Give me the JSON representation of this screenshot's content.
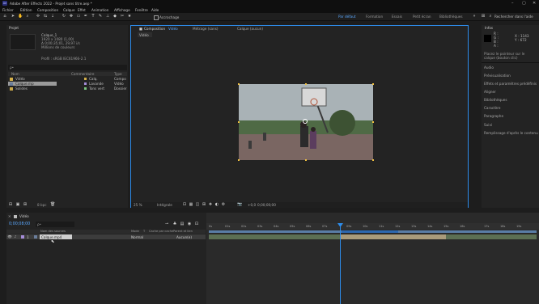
{
  "window": {
    "title": "Adobe After Effects 2022 - Projet sans titre.aep *",
    "min": "–",
    "max": "▢",
    "close": "✕"
  },
  "menu": [
    "Fichier",
    "Edition",
    "Composition",
    "Calque",
    "Effet",
    "Animation",
    "Affichage",
    "Fenêtre",
    "Aide"
  ],
  "toolbar": {
    "snap_label": "Accrochage",
    "workspaces": [
      "Par défaut",
      "Formation",
      "Essais",
      "Petit écran",
      "Bibliothèques"
    ],
    "help_search": "Rechercher dans l'aide"
  },
  "project": {
    "tab": "Projet",
    "comp_name": "Calque_1",
    "comp_info1": "1920 x 1080 (1,00)",
    "comp_info2": "Δ 0;00;35;01, 29,97 i/s",
    "comp_info3": "Millions de couleurs",
    "comp_info4": "Profil : sRGB IEC61966-2.1",
    "search_placeholder": "ρ•",
    "col_name": "Nom",
    "col_label": "Commentaire",
    "col_type": "Type",
    "items": [
      {
        "name": "Vidéo",
        "label": "Calq.",
        "type": "Compo",
        "color": "#d4b04a"
      },
      {
        "name": "Calque.mp",
        "label": "Lavande",
        "type": "Vidéo",
        "color": "#a58cd9"
      },
      {
        "name": "Solides",
        "label": "Tons vert",
        "type": "Dossier",
        "color": "#7bc47f"
      }
    ],
    "bpc": "8 bpc"
  },
  "composition": {
    "tab": "Composition",
    "comp_name": "Vidéo",
    "footage_tab": "Métrage (sans)",
    "layer_tab": "Calque (aucun)",
    "subtab": "Vidéo",
    "zoom": "25 %",
    "resolution": "Intégrale",
    "timecode": "0;00;00;00",
    "plus": "+0,0"
  },
  "info": {
    "tab": "Infos",
    "r": "R :",
    "g": "G :",
    "b": "B :",
    "a": "A :",
    "x": "X : 1143",
    "y": "Y : 672",
    "hint": "Placez le pointeur sur le calque (bouton clic)",
    "panels": [
      "Audio",
      "Prévisualisation",
      "Effets et paramètres prédéfinis",
      "Aligner",
      "Bibliothèques",
      "Caractère",
      "Paragraphe",
      "Suivi",
      "Remplissage d'après le contenu"
    ]
  },
  "timeline": {
    "tab": "Vidéo",
    "timecode": "0;00;08;00",
    "search_placeholder": "ρ•",
    "col_source": "Nom des sources",
    "col_switch": "Mode",
    "col_trkmat": "T",
    "col_cache": "Cache par cache",
    "col_parent": "Parent et lien",
    "layer_num": "1",
    "layer_name": "Calque.mp4",
    "layer_mode": "Normal",
    "layer_parent": "Aucun(e)",
    "ruler": [
      "0s",
      "01s",
      "02s",
      "03s",
      "04s",
      "05s",
      "06s",
      "07s",
      "08s",
      "09s",
      "10s",
      "11s",
      "12s",
      "13s",
      "14s",
      "15s",
      "16s",
      "17s",
      "18s",
      "19s"
    ],
    "bar_color": "#5a7da6",
    "layer_bar_color": "#a99b7b",
    "playhead_color": "#2d8ceb"
  }
}
